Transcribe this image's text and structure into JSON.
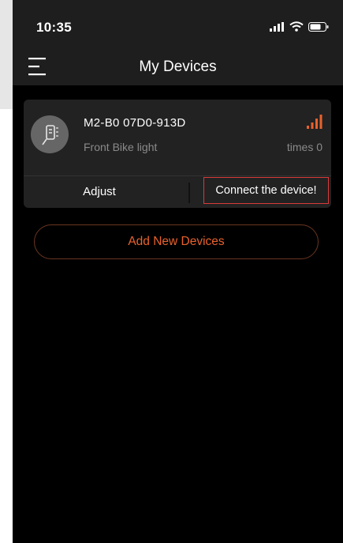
{
  "status_bar": {
    "time": "10:35",
    "icons": [
      "cellular-signal-icon",
      "wifi-icon",
      "battery-icon"
    ]
  },
  "nav": {
    "title": "My Devices",
    "menu_icon": "menu-icon"
  },
  "device": {
    "name": "M2-B0 07D0-913D",
    "type": "Front Bike light",
    "times_label": "times 0",
    "avatar_icon": "bike-light-icon",
    "signal_icon": "signal-strength-icon",
    "actions": {
      "adjust_label": "Adjust",
      "connect_label": "Connect the device!"
    }
  },
  "add_button_label": "Add New Devices",
  "colors": {
    "accent": "#e8622c",
    "highlight_border": "#d83a3a",
    "background": "#000000",
    "header": "#1e1e1e",
    "card": "#222222"
  }
}
